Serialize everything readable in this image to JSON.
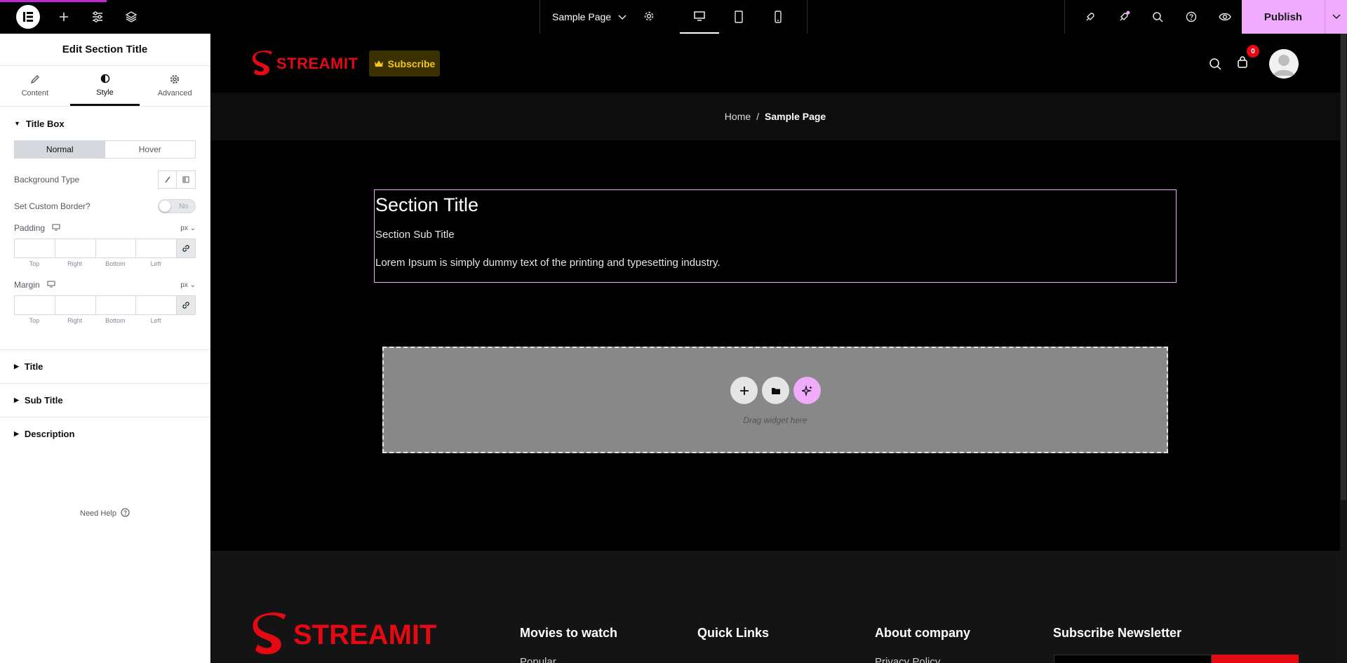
{
  "topbar": {
    "page_name": "Sample Page",
    "publish_label": "Publish",
    "colors": {
      "accent": "#f0abfc",
      "progress": "#c026d3"
    }
  },
  "panel": {
    "title": "Edit Section Title",
    "tabs": [
      {
        "label": "Content",
        "icon": "pencil-icon"
      },
      {
        "label": "Style",
        "icon": "half-circle-icon"
      },
      {
        "label": "Advanced",
        "icon": "gear-icon"
      }
    ],
    "title_box": {
      "heading": "Title Box",
      "state_normal": "Normal",
      "state_hover": "Hover",
      "background_type_label": "Background Type",
      "custom_border_label": "Set Custom Border?",
      "custom_border_value": "No",
      "padding_label": "Padding",
      "margin_label": "Margin",
      "unit": "px",
      "dim_top": "Top",
      "dim_right": "Right",
      "dim_bottom": "Bottom",
      "dim_left": "Left"
    },
    "sections": {
      "title": "Title",
      "sub_title": "Sub Title",
      "description": "Description"
    },
    "need_help": "Need Help"
  },
  "preview": {
    "brand": "STREAMIT",
    "subscribe_label": "Subscribe",
    "cart_count": "0",
    "breadcrumb": {
      "home": "Home",
      "separator": "/",
      "current": "Sample Page"
    },
    "section": {
      "title": "Section Title",
      "sub_title": "Section Sub Title",
      "description": "Lorem Ipsum is simply dummy text of the printing and typesetting industry."
    },
    "dropzone_text": "Drag widget here",
    "footer": {
      "brand": "STREAMIT",
      "columns": [
        "Movies to watch",
        "Quick Links",
        "About company",
        "Subscribe Newsletter"
      ],
      "link_movies": "Popular",
      "link_about": "Privacy Policy"
    }
  }
}
